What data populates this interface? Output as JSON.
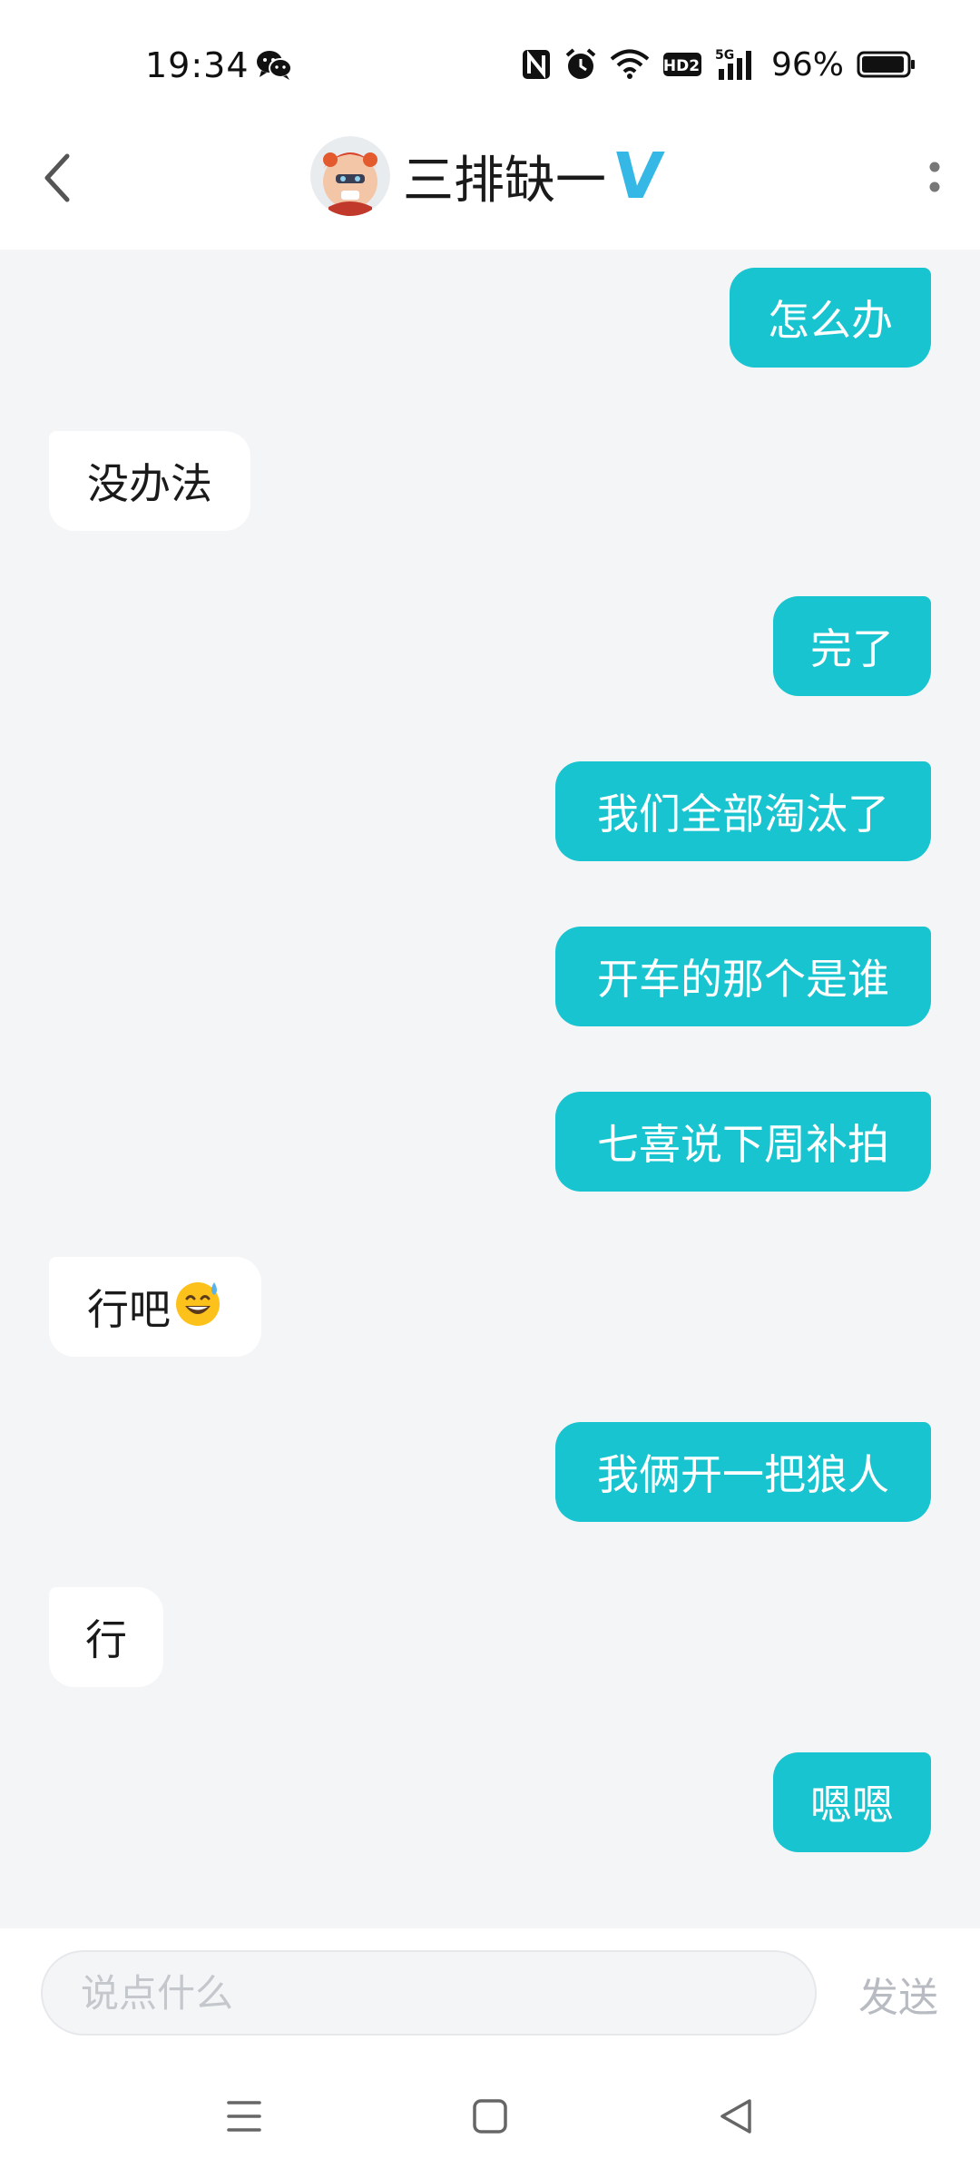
{
  "status_bar": {
    "time": "19:34",
    "battery_percent": "96%",
    "network_label": "5G",
    "hd_label": "HD2",
    "icons": [
      "wechat-icon",
      "nfc-icon",
      "alarm-icon",
      "wifi-icon",
      "hd-voice-icon",
      "signal-icon",
      "battery-icon"
    ]
  },
  "header": {
    "title": "三排缺一",
    "badge": "V",
    "icons": [
      "back-icon",
      "avatar",
      "more-icon"
    ]
  },
  "messages": [
    {
      "side": "sent",
      "text": "怎么办"
    },
    {
      "side": "recv",
      "text": "没办法"
    },
    {
      "side": "sent",
      "text": "完了"
    },
    {
      "side": "sent",
      "text": "我们全部淘汰了"
    },
    {
      "side": "sent",
      "text": "开车的那个是谁"
    },
    {
      "side": "sent",
      "text": "七喜说下周补拍"
    },
    {
      "side": "recv",
      "text": "行吧",
      "emoji": "sweat-smile-emoji"
    },
    {
      "side": "sent",
      "text": "我俩开一把狼人"
    },
    {
      "side": "recv",
      "text": "行"
    },
    {
      "side": "sent",
      "text": "嗯嗯"
    }
  ],
  "input_bar": {
    "placeholder": "说点什么",
    "value": "",
    "send_label": "发送"
  },
  "nav_bar": {
    "icons": [
      "menu-icon",
      "home-icon",
      "back-triangle-icon"
    ]
  },
  "colors": {
    "sent_bubble": "#17c4cf",
    "recv_bubble": "#ffffff",
    "chat_background": "#f4f5f7",
    "vip_badge": "#35b8e6"
  }
}
